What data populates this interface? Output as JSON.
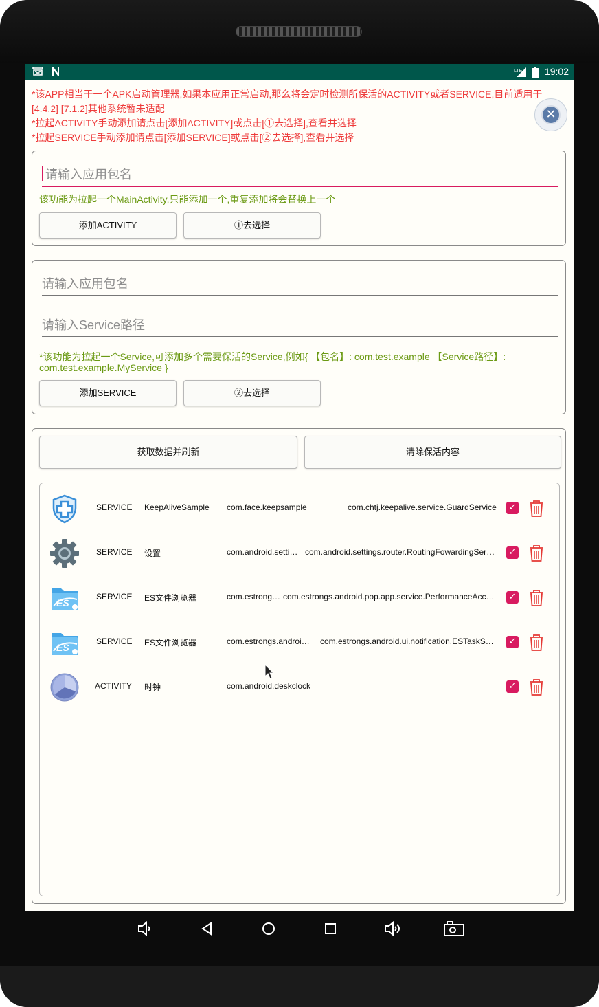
{
  "status_bar": {
    "time": "19:02",
    "network": "LTE"
  },
  "notice": {
    "lines": [
      "*该APP相当于一个APK启动管理器,如果本应用正常启动,那么将会定时检测所保活的ACTIVITY或者SERVICE,目前适用于",
      "[4.4.2] [7.1.2]其他系统暂未适配",
      "*拉起ACTIVITY手动添加请点击[添加ACTIVITY]或点击[①去选择],查看并选择",
      "*拉起SERVICE手动添加请点击[添加SERVICE]或点击[②去选择],查看并选择"
    ]
  },
  "activity_section": {
    "package_placeholder": "请输入应用包名",
    "hint": "该功能为拉起一个MainActivity,只能添加一个,重复添加将会替换上一个",
    "add_button": "添加ACTIVITY",
    "select_button": "①去选择"
  },
  "service_section": {
    "package_placeholder": "请输入应用包名",
    "path_placeholder": "请输入Service路径",
    "hint_line1": "*该功能为拉起一个Service,可添加多个需要保活的Service,例如{ 【包名】: com.test.example 【Service路径】:",
    "hint_line2": "com.test.example.MyService }",
    "add_button": "添加SERVICE",
    "select_button": "②去选择"
  },
  "list_section": {
    "refresh_button": "获取数据并刷新",
    "clear_button": "清除保活内容",
    "items": [
      {
        "icon": "shield-plus-icon",
        "type": "SERVICE",
        "name": "KeepAliveSample",
        "package": "com.face.keepsample",
        "path": "com.chtj.keepalive.service.GuardService",
        "checked": true
      },
      {
        "icon": "settings-gear-icon",
        "type": "SERVICE",
        "name": "设置",
        "package": "com.android.setti…",
        "path": "com.android.settings.router.RoutingFowardingSer…",
        "checked": true
      },
      {
        "icon": "es-file-explorer-icon",
        "type": "SERVICE",
        "name": "ES文件浏览器",
        "package": "com.estrong…",
        "path": "com.estrongs.android.pop.app.service.PerformanceAcc…",
        "checked": true
      },
      {
        "icon": "es-file-explorer-icon",
        "type": "SERVICE",
        "name": "ES文件浏览器",
        "package": "com.estrongs.androi…",
        "path": "com.estrongs.android.ui.notification.ESTaskS…",
        "checked": true
      },
      {
        "icon": "clock-app-icon",
        "type": "ACTIVITY",
        "name": "时钟",
        "package": "com.android.deskclock",
        "path": "",
        "checked": true
      }
    ]
  },
  "colors": {
    "status_bar": "#00574b",
    "notice_text": "#ee3b3b",
    "hint_text": "#6b9a14",
    "accent": "#d81b60",
    "trash": "#e53935"
  }
}
